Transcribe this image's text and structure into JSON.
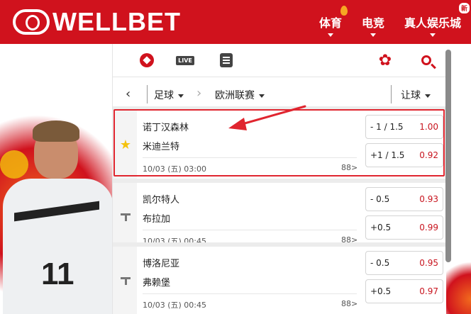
{
  "brand": {
    "name": "WELLBET",
    "accent_color": "#d0121d"
  },
  "nav": {
    "items": [
      {
        "label": "体育",
        "badge": "flame-icon"
      },
      {
        "label": "电竞"
      },
      {
        "label": "真人娱乐城",
        "badge": "新"
      }
    ]
  },
  "toolbar": {
    "icons": [
      "soccer-ball-icon",
      "live-icon",
      "list-icon",
      "gear-icon",
      "search-icon"
    ],
    "live_label": "LIVE"
  },
  "filter": {
    "back_label": "‹",
    "sport": "足球",
    "chev": "›",
    "league": "欧洲联赛",
    "market": "让球"
  },
  "matches": [
    {
      "home": "诺丁汉森林",
      "away": "米迪兰特",
      "time": "10/03 (五) 03:00",
      "more": "88>",
      "fav": "star",
      "odds": [
        {
          "hcp": "- 1 / 1.5",
          "price": "1.00"
        },
        {
          "hcp": "+1 / 1.5",
          "price": "0.92"
        }
      ]
    },
    {
      "home": "凯尔特人",
      "away": "布拉加",
      "time": "10/03 (五) 00:45",
      "more": "88>",
      "fav": "pin",
      "odds": [
        {
          "hcp": "- 0.5",
          "price": "0.93"
        },
        {
          "hcp": "+0.5",
          "price": "0.99"
        }
      ]
    },
    {
      "home": "博洛尼亚",
      "away": "弗赖堡",
      "time": "10/03 (五) 00:45",
      "more": "88>",
      "fav": "pin",
      "odds": [
        {
          "hcp": "- 0.5",
          "price": "0.95"
        },
        {
          "hcp": "+0.5",
          "price": "0.97"
        }
      ]
    }
  ],
  "banner": {
    "shirt_number": "11"
  }
}
